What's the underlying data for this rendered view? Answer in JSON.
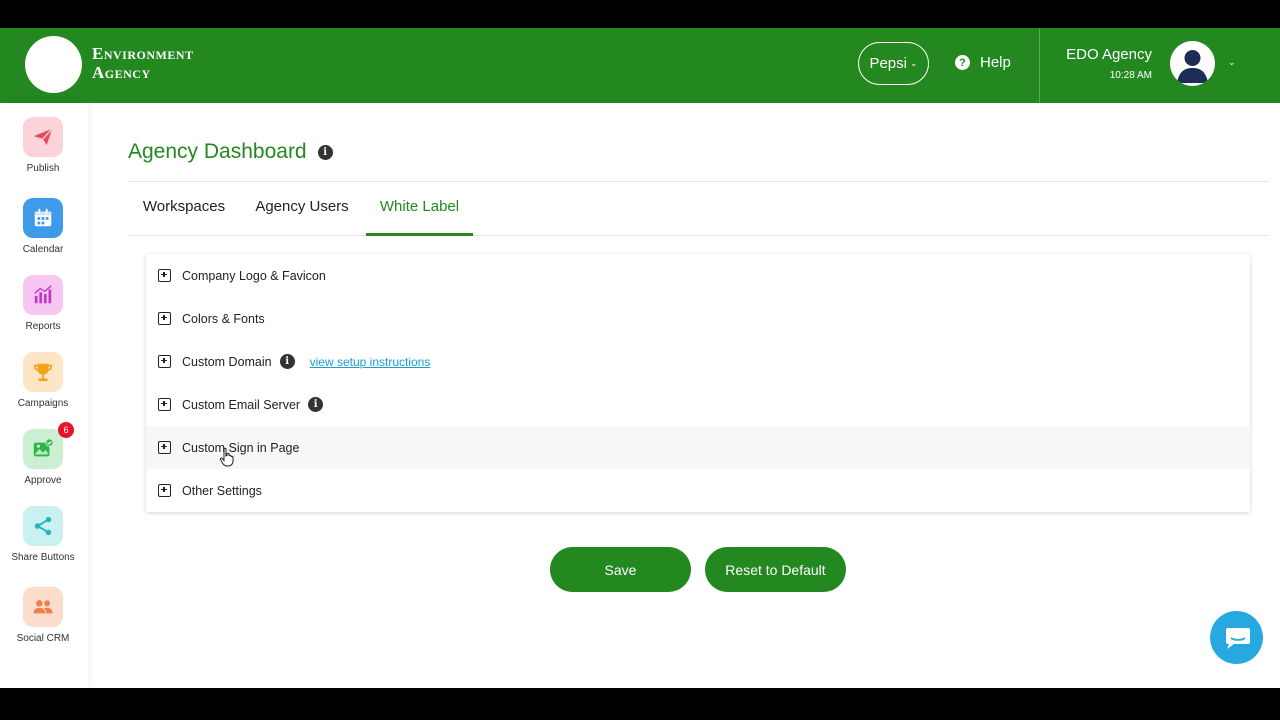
{
  "header": {
    "brand_line1": "Environment",
    "brand_line2": "Agency",
    "workspace_selector": "Pepsi",
    "help_label": "Help",
    "account_name": "EDO Agency",
    "time": "10:28 AM",
    "color": "#23881f"
  },
  "sidebar": {
    "items": [
      {
        "label": "Publish",
        "icon": "paper-plane-icon",
        "bg": "#fbd3d9",
        "color": "#e84a5f"
      },
      {
        "label": "Calendar",
        "icon": "calendar-icon",
        "bg": "#3d9bea",
        "color": "#ffffff"
      },
      {
        "label": "Reports",
        "icon": "bar-chart-icon",
        "bg": "#f7c6f2",
        "color": "#c236c9"
      },
      {
        "label": "Campaigns",
        "icon": "trophy-icon",
        "bg": "#fde6c6",
        "color": "#f3a21c"
      },
      {
        "label": "Approve",
        "icon": "image-check-icon",
        "bg": "#ccefd2",
        "color": "#2fb44a",
        "badge": "6"
      },
      {
        "label": "Share Buttons",
        "icon": "share-icon",
        "bg": "#c9f1f1",
        "color": "#24b6b3"
      },
      {
        "label": "Social CRM",
        "icon": "users-icon",
        "bg": "#fcdccb",
        "color": "#ef7e4e"
      }
    ]
  },
  "main": {
    "title": "Agency Dashboard",
    "tabs": [
      {
        "label": "Workspaces",
        "active": false
      },
      {
        "label": "Agency Users",
        "active": false
      },
      {
        "label": "White Label",
        "active": true
      }
    ],
    "sections": [
      {
        "label": "Company Logo & Favicon"
      },
      {
        "label": "Colors & Fonts"
      },
      {
        "label": "Custom Domain",
        "info": true,
        "link": "view setup instructions"
      },
      {
        "label": "Custom Email Server",
        "info": true
      },
      {
        "label": "Custom Sign in Page"
      },
      {
        "label": "Other Settings"
      }
    ],
    "save_label": "Save",
    "reset_label": "Reset to Default"
  }
}
